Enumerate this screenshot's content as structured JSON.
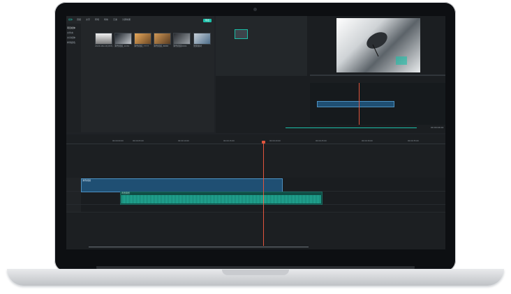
{
  "app": {
    "menu": [
      "媒体",
      "音频",
      "文字",
      "转场",
      "特效",
      "元素",
      "分屏效果"
    ],
    "import_button": "导出",
    "sidebar_items": [
      "项目媒体",
      "文件夹",
      "共享媒体",
      "样例颜色"
    ],
    "media_thumbs": [
      {
        "label": "2020-06-13(033)"
      },
      {
        "label": "滑雪视频_1234"
      },
      {
        "label": "滑雪视频_7777"
      },
      {
        "label": "滑雪视频_8888"
      },
      {
        "label": "滑雪视频0001"
      },
      {
        "label": "录屏素材"
      }
    ],
    "preview": {
      "timecode": "00:00:04:04"
    },
    "timeline": {
      "ticks": [
        "00:00:00:00",
        "00:00:05:00",
        "00:00:10:00",
        "00:00:15:00",
        "00:00:20:00",
        "00:00:25:00",
        "00:00:30:00",
        "00:00:35:00",
        "00:00:40:00"
      ],
      "video_clip_label": "滑雪视频",
      "audio_clip_label": "背景音乐"
    }
  },
  "colors": {
    "accent": "#1bbfa8",
    "video_clip": "#1f4f73",
    "audio_clip": "#0f4d45",
    "playhead": "#e2553d"
  }
}
